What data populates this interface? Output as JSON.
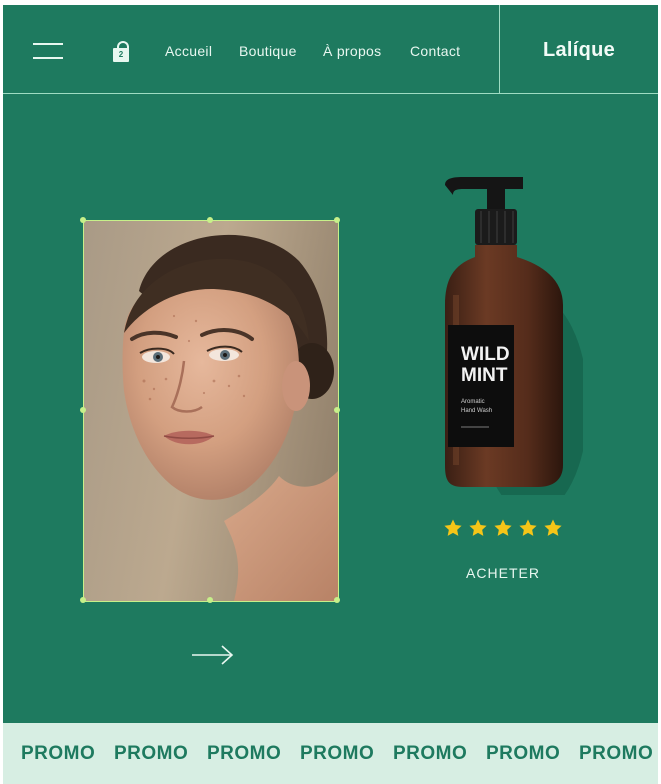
{
  "header": {
    "cart_count": "2",
    "nav": [
      "Accueil",
      "Boutique",
      "À propos",
      "Contact"
    ],
    "brand": "Lalíque"
  },
  "product": {
    "label_line1": "WILD",
    "label_line2": "MINT",
    "label_sub1": "Aromatic",
    "label_sub2": "Hand Wash",
    "rating": 5,
    "rating_max": 5,
    "star_color": "#f5c518",
    "buy_label": "ACHETER"
  },
  "colors": {
    "background": "#1e7a5f",
    "selection": "#c7f08a",
    "promo_bg": "#d7eee3"
  },
  "icons": {
    "menu": "hamburger-icon",
    "cart": "shopping-bag-icon",
    "next": "arrow-right-icon",
    "rating": "star-icon"
  },
  "promo": {
    "items": [
      "PROMO",
      "PROMO",
      "PROMO",
      "PROMO",
      "PROMO",
      "PROMO",
      "PROMO"
    ]
  }
}
